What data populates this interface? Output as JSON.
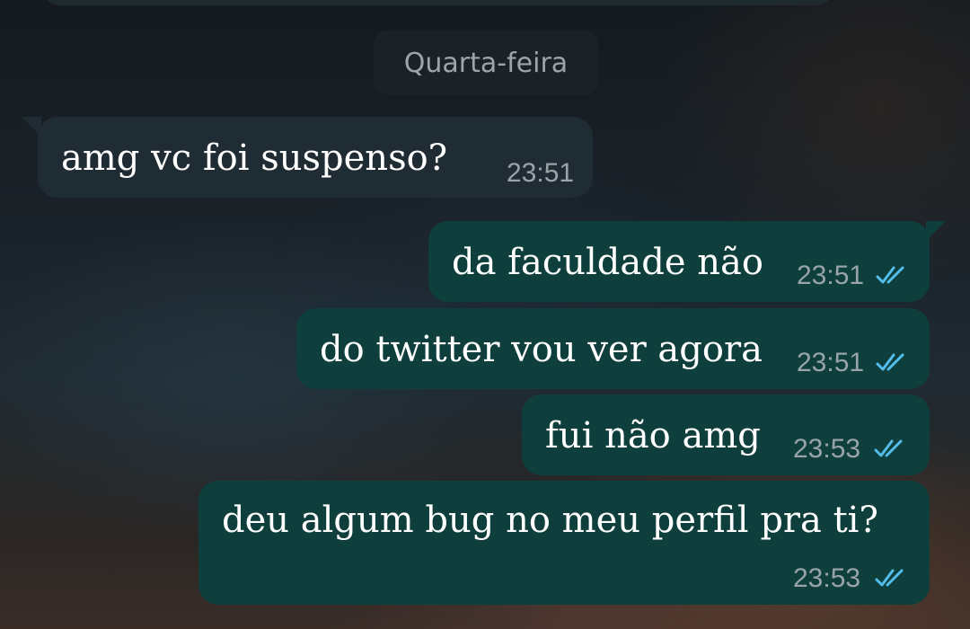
{
  "chat": {
    "date_separator": "Quarta-feira",
    "messages": [
      {
        "direction": "incoming",
        "text": "amg vc foi suspenso?",
        "time": "23:51"
      },
      {
        "direction": "outgoing",
        "text": "da faculdade não",
        "time": "23:51",
        "status": "read"
      },
      {
        "direction": "outgoing",
        "text": "do twitter vou ver agora",
        "time": "23:51",
        "status": "read"
      },
      {
        "direction": "outgoing",
        "text": "fui não amg",
        "time": "23:53",
        "status": "read"
      },
      {
        "direction": "outgoing",
        "text": "deu algum bug no meu perfil pra ti?",
        "time": "23:53",
        "status": "read"
      }
    ]
  },
  "colors": {
    "incoming_bubble": "#202c33",
    "outgoing_bubble": "#0f3f3c",
    "read_ticks": "#53bdeb",
    "time_text": "#98a4a8"
  },
  "icons": {
    "read_receipt": "double-check-icon"
  }
}
